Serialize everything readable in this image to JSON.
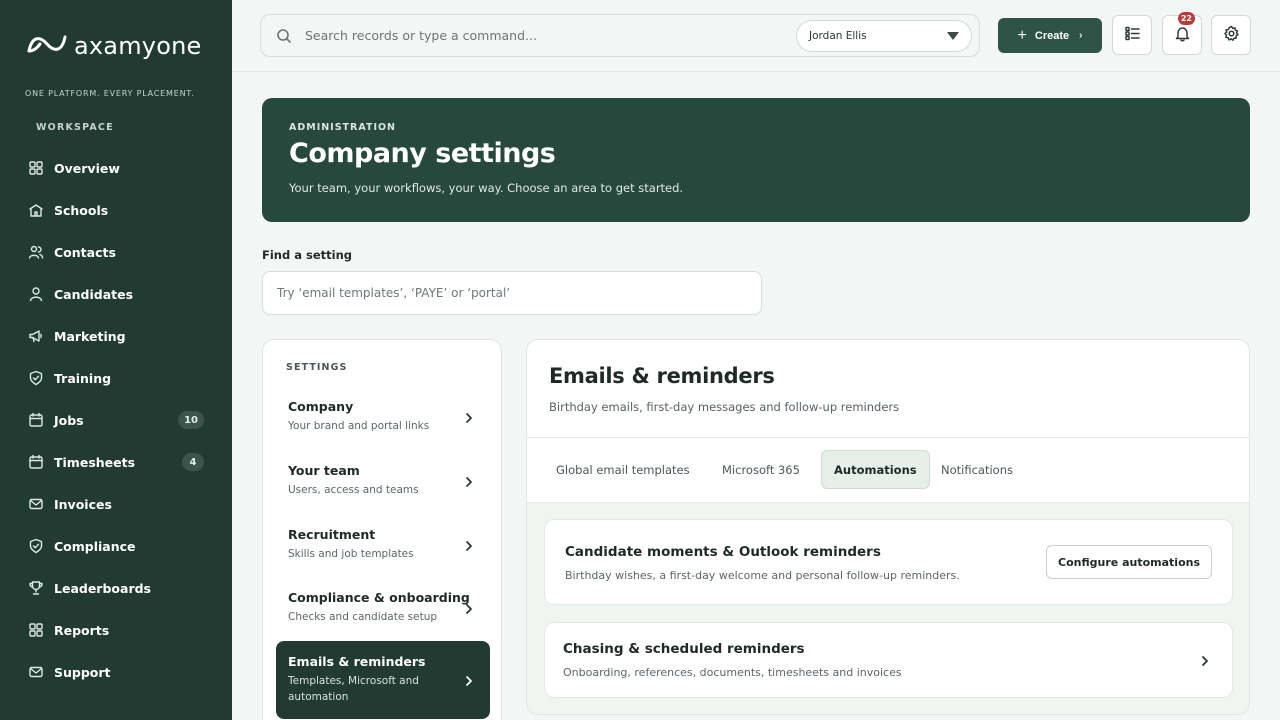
{
  "brand": {
    "name": "axamyone",
    "tagline": "ONE PLATFORM. EVERY PLACEMENT.",
    "logo_icon": "infinity-wave-logo"
  },
  "sidebar": {
    "section_label": "WORKSPACE",
    "items": [
      {
        "label": "Overview",
        "icon": "grid-icon"
      },
      {
        "label": "Schools",
        "icon": "school-icon"
      },
      {
        "label": "Contacts",
        "icon": "users-icon"
      },
      {
        "label": "Candidates",
        "icon": "user-icon"
      },
      {
        "label": "Marketing",
        "icon": "megaphone-icon"
      },
      {
        "label": "Training",
        "icon": "shield-icon"
      },
      {
        "label": "Jobs",
        "icon": "calendar-icon",
        "badge": "10"
      },
      {
        "label": "Timesheets",
        "icon": "calendar-icon",
        "badge": "4"
      },
      {
        "label": "Invoices",
        "icon": "mail-icon"
      },
      {
        "label": "Compliance",
        "icon": "shield-icon"
      },
      {
        "label": "Leaderboards",
        "icon": "trophy-icon"
      },
      {
        "label": "Reports",
        "icon": "grid-icon"
      },
      {
        "label": "Support",
        "icon": "mail-icon"
      }
    ]
  },
  "topbar": {
    "search_placeholder": "Search records or type a command...",
    "user_select_value": "Jordan Ellis",
    "create_label": "Create",
    "notifications_count": "22"
  },
  "hero": {
    "kicker": "ADMINISTRATION",
    "title": "Company settings",
    "subtitle": "Your team, your workflows, your way. Choose an area to get started."
  },
  "find": {
    "label": "Find a setting",
    "placeholder": "Try ‘email templates’, ‘PAYE’ or ‘portal’"
  },
  "settings": {
    "heading": "SETTINGS",
    "items": [
      {
        "title": "Company",
        "desc": "Your brand and portal links"
      },
      {
        "title": "Your team",
        "desc": "Users, access and teams"
      },
      {
        "title": "Recruitment",
        "desc": "Skills and job templates"
      },
      {
        "title": "Compliance & onboarding",
        "desc": "Checks and candidate setup"
      },
      {
        "title": "Emails & reminders",
        "desc": "Templates, Microsoft and automation",
        "active": true
      }
    ]
  },
  "detail": {
    "title": "Emails & reminders",
    "subtitle": "Birthday emails, first-day messages and follow-up reminders",
    "tabs": [
      {
        "label": "Global email templates"
      },
      {
        "label": "Microsoft 365"
      },
      {
        "label": "Automations",
        "active": true
      },
      {
        "label": "Notifications"
      }
    ],
    "cards": [
      {
        "title": "Candidate moments & Outlook reminders",
        "desc": "Birthday wishes, a first-day welcome and personal follow-up reminders.",
        "action": "Configure automations"
      },
      {
        "title": "Chasing & scheduled reminders",
        "desc": "Onboarding, references, documents, timesheets and invoices"
      }
    ]
  },
  "colors": {
    "sidebar_bg": "#213b33",
    "accent": "#2d5446",
    "hero_bg": "#27493d",
    "badge_red": "#b93a3a"
  }
}
